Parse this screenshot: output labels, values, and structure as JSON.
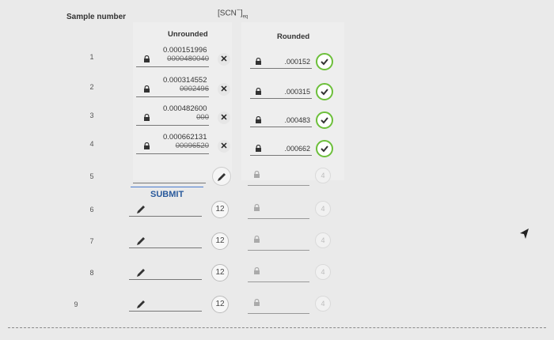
{
  "header": {
    "sample_number": "Sample number",
    "scn": "[SCN",
    "scn_sup": "−",
    "scn_close": "]",
    "scn_sub": "eq",
    "unrounded": "Unrounded",
    "rounded": "Rounded"
  },
  "submit_label": "SUBMIT",
  "rows_done": [
    {
      "num": "1",
      "unrounded": "0.000151996",
      "old": "0000480040",
      "rounded": ".000152"
    },
    {
      "num": "2",
      "unrounded": "0.000314552",
      "old": "0002496",
      "rounded": ".000315"
    },
    {
      "num": "3",
      "unrounded": "0.000482600",
      "old": "000",
      "rounded": ".000483"
    },
    {
      "num": "4",
      "unrounded": "0.000662131",
      "old": "00096520",
      "rounded": ".000662"
    }
  ],
  "rows_pending": [
    {
      "num": "5",
      "sig": "",
      "round_badge": "4"
    },
    {
      "num": "6",
      "sig": "12",
      "round_badge": "4"
    },
    {
      "num": "7",
      "sig": "12",
      "round_badge": "4"
    },
    {
      "num": "8",
      "sig": "12",
      "round_badge": "4"
    },
    {
      "num": "9",
      "sig": "12",
      "round_badge": "4"
    }
  ],
  "colors": {
    "check_green": "#6cbf3a",
    "link_blue": "#2a5a9c"
  },
  "icons": [
    "lock-icon",
    "close-icon",
    "check-icon",
    "pencil-icon",
    "mouse-cursor-icon"
  ]
}
